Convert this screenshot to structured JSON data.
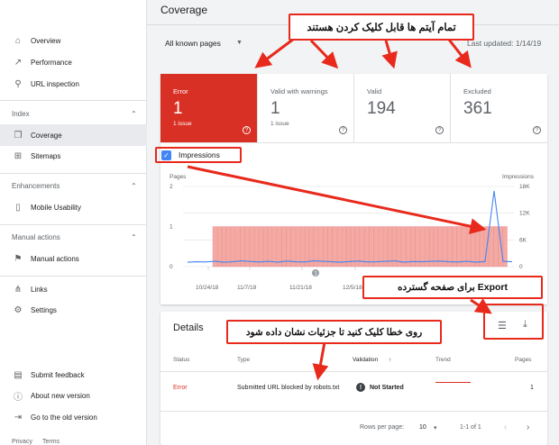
{
  "sidebar": {
    "items": [
      {
        "label": "Overview",
        "icon": "home-icon"
      },
      {
        "label": "Performance",
        "icon": "trending-up-icon"
      },
      {
        "label": "URL inspection",
        "icon": "search-icon"
      }
    ],
    "sections": [
      {
        "title": "Index",
        "items": [
          {
            "label": "Coverage",
            "icon": "copy-icon"
          },
          {
            "label": "Sitemaps",
            "icon": "sitemap-icon"
          }
        ]
      },
      {
        "title": "Enhancements",
        "items": [
          {
            "label": "Mobile Usability",
            "icon": "phone-icon"
          }
        ]
      },
      {
        "title": "Manual actions",
        "items": [
          {
            "label": "Manual actions",
            "icon": "flag-icon"
          }
        ]
      }
    ],
    "bottom": [
      {
        "label": "Links",
        "icon": "links-icon"
      },
      {
        "label": "Settings",
        "icon": "gear-icon"
      }
    ],
    "footer": [
      {
        "label": "Submit feedback",
        "icon": "feedback-icon"
      },
      {
        "label": "About new version",
        "icon": "info-icon"
      },
      {
        "label": "Go to the old version",
        "icon": "exit-icon"
      }
    ],
    "legal": {
      "privacy": "Privacy",
      "terms": "Terms"
    }
  },
  "header": {
    "title": "Coverage",
    "filter": "All known pages",
    "updated": "Last updated: 1/14/19"
  },
  "tiles": [
    {
      "label": "Error",
      "value": "1",
      "sub": "1 issue"
    },
    {
      "label": "Valid with warnings",
      "value": "1",
      "sub": "1 issue"
    },
    {
      "label": "Valid",
      "value": "194",
      "sub": ""
    },
    {
      "label": "Excluded",
      "value": "361",
      "sub": ""
    }
  ],
  "impressions": {
    "label": "Impressions",
    "checked": true
  },
  "chart_data": {
    "type": "bar",
    "title": "",
    "left_axis_title": "Pages",
    "right_axis_title": "Impressions",
    "left_ticks": [
      "2",
      "1",
      "0"
    ],
    "right_ticks": [
      "18K",
      "12K",
      "6K",
      "0"
    ],
    "x_ticks": [
      "10/24/18",
      "11/7/18",
      "11/21/18",
      "12/5/18"
    ],
    "ylim_left": [
      0,
      2
    ],
    "ylim_right": [
      0,
      18000
    ],
    "series": [
      {
        "name": "Error pages",
        "values_description": "error count",
        "value_from": "11/1/18",
        "value_to": "1/14/19",
        "value": 1
      },
      {
        "name": "Impressions",
        "values": [
          1000,
          1100,
          1050,
          1200,
          1000,
          1100,
          1300,
          1150,
          1050,
          1200,
          1000,
          1250,
          1100,
          1050,
          1300,
          1200,
          1100,
          1000,
          1150,
          1250,
          1050,
          1100,
          1200,
          1300,
          1000,
          1150,
          1100,
          1200,
          1250,
          1100,
          1050,
          1200,
          1000,
          1150,
          17000,
          1200,
          1100
        ]
      }
    ],
    "annotation_marker": "1"
  },
  "details": {
    "title": "Details",
    "columns": {
      "status": "Status",
      "type": "Type",
      "validation": "Validation",
      "trend": "Trend",
      "pages": "Pages"
    },
    "rows": [
      {
        "status": "Error",
        "type": "Submitted URL blocked by robots.txt",
        "validation": "Not Started",
        "pages": "1"
      }
    ],
    "footer": {
      "rows_per_page_label": "Rows per page:",
      "rows_per_page": "10",
      "range": "1-1 of 1"
    }
  },
  "annotations": {
    "top": "تمام آیتم ها قابل کلیک کردن هستند",
    "export": "Export برای صفحه گسترده",
    "details": "روی خطا کلیک کنید تا جزئیات نشان داده شود"
  },
  "colors": {
    "error": "#d93025",
    "accent": "#4285f4",
    "callout_border": "#e8291c",
    "bar_fill": "#f4a9a3"
  }
}
